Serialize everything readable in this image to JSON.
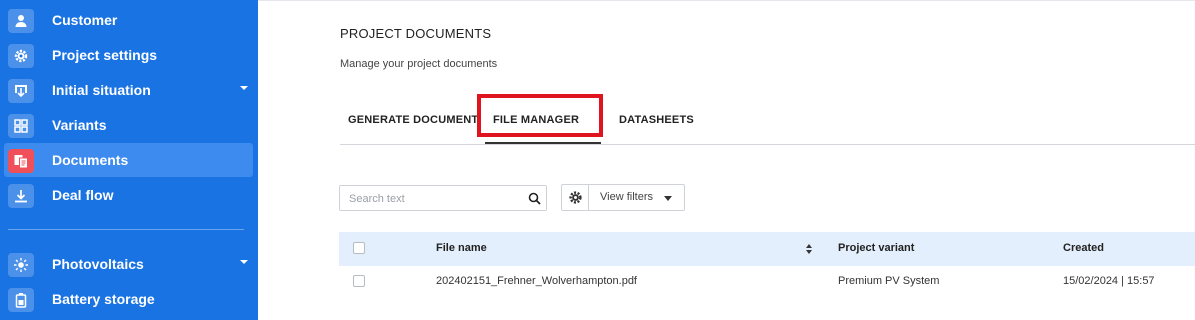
{
  "sidebar": {
    "items": [
      {
        "label": "Customer",
        "icon": "user-icon"
      },
      {
        "label": "Project settings",
        "icon": "gear-icon"
      },
      {
        "label": "Initial situation",
        "icon": "download-box-icon",
        "expandable": true
      },
      {
        "label": "Variants",
        "icon": "grid-icon"
      },
      {
        "label": "Documents",
        "icon": "documents-icon",
        "active": true
      },
      {
        "label": "Deal flow",
        "icon": "download-icon"
      },
      {
        "label": "Photovoltaics",
        "icon": "sun-icon",
        "expandable": true
      },
      {
        "label": "Battery storage",
        "icon": "battery-icon"
      }
    ]
  },
  "header": {
    "title": "PROJECT DOCUMENTS",
    "subtitle": "Manage your project documents"
  },
  "tabs": [
    {
      "label": "GENERATE DOCUMENT"
    },
    {
      "label": "FILE MANAGER",
      "active": true
    },
    {
      "label": "DATASHEETS"
    }
  ],
  "toolbar": {
    "search_placeholder": "Search text",
    "filter_label": "View filters"
  },
  "table": {
    "columns": [
      "File name",
      "Project variant",
      "Created"
    ],
    "rows": [
      {
        "file_name": "202402151_Frehner_Wolverhampton.pdf",
        "variant": "Premium PV System",
        "created": "15/02/2024 | 15:57"
      }
    ]
  },
  "colors": {
    "sidebar": "#1a73e3",
    "active_item": "#3d8bee",
    "highlight": "#e0141e",
    "table_header": "#e3effc"
  }
}
